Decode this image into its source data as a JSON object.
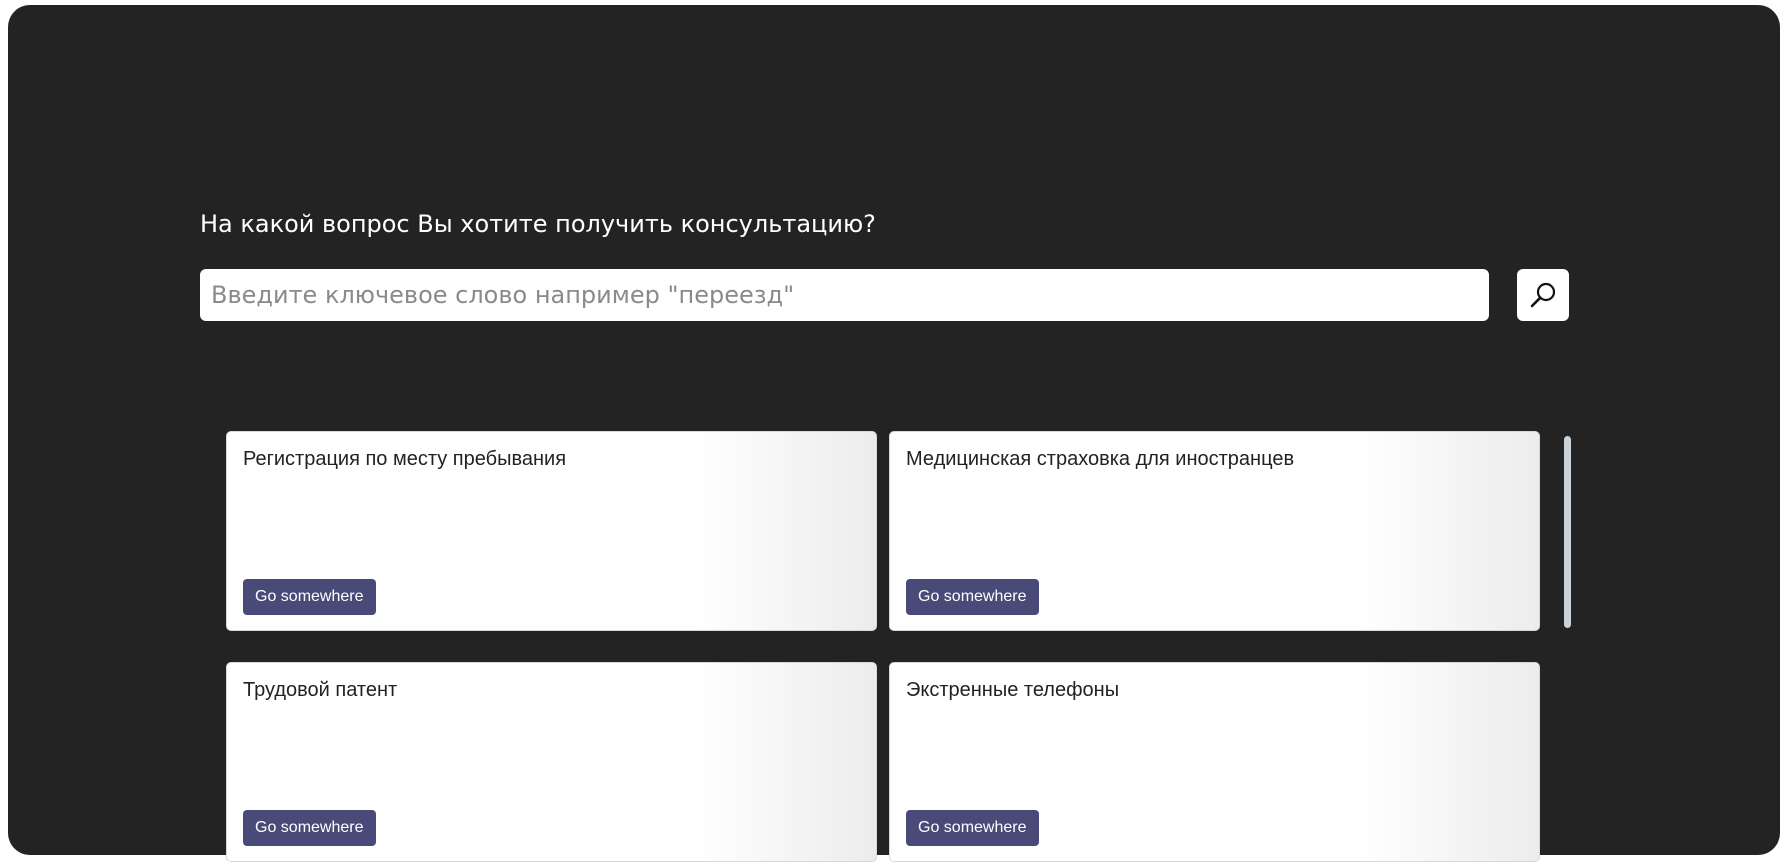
{
  "consultation": {
    "question": "На какой вопрос Вы хотите получить консультацию?"
  },
  "search": {
    "placeholder": "Введите ключевое слово например \"переезд\"",
    "value": "",
    "button_icon": "search-icon"
  },
  "cards": [
    {
      "title": "Регистрация по месту пребывания",
      "button_label": "Go somewhere"
    },
    {
      "title": "Медицинская страховка для иностранцев",
      "button_label": "Go somewhere"
    },
    {
      "title": "Трудовой патент",
      "button_label": "Go somewhere"
    },
    {
      "title": "Экстренные телефоны",
      "button_label": "Go somewhere"
    }
  ],
  "colors": {
    "background": "#232323",
    "card_button": "#4a4a78",
    "scrollbar": "#c9d3d9"
  }
}
